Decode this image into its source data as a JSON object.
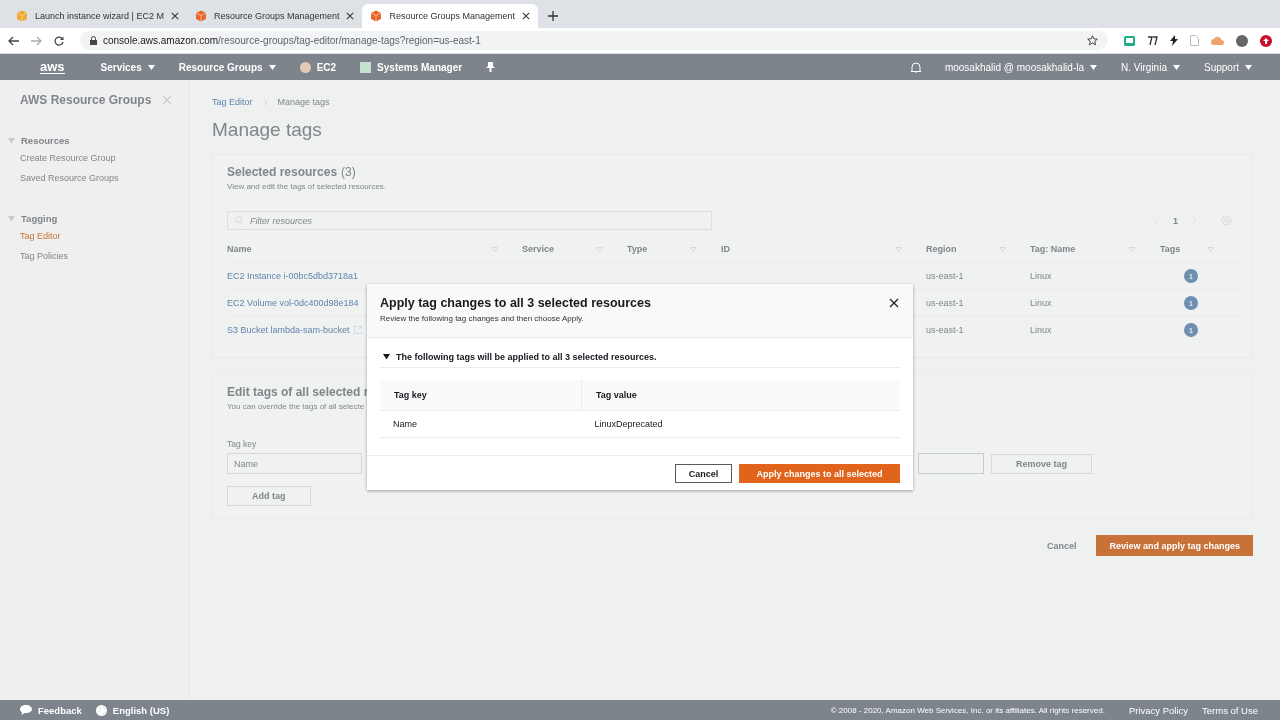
{
  "browser": {
    "tabs": [
      {
        "title": "Launch instance wizard | EC2 M",
        "kind": "ec2",
        "selected": false
      },
      {
        "title": "Resource Groups Management",
        "kind": "rg",
        "selected": false
      },
      {
        "title": "Resource Groups Management",
        "kind": "rg",
        "selected": true
      }
    ],
    "url_host": "console.aws.amazon.com",
    "url_path": "/resource-groups/tag-editor/manage-tags?region=us-east-1"
  },
  "nav": {
    "logo": "aws",
    "items": [
      {
        "label": "Services",
        "kind": "menu"
      },
      {
        "label": "Resource Groups",
        "kind": "menu"
      },
      {
        "label": "EC2",
        "kind": "ec2"
      },
      {
        "label": "Systems Manager",
        "kind": "ssm"
      }
    ],
    "account": "moosakhalid @ moosakhalid-la",
    "region": "N. Virginia",
    "support": "Support"
  },
  "sidebar": {
    "title": "AWS Resource Groups",
    "sections": [
      {
        "label": "Resources",
        "expanded": true,
        "items": [
          {
            "label": "Create Resource Group",
            "selected": false
          },
          {
            "label": "Saved Resource Groups",
            "selected": false
          }
        ]
      },
      {
        "label": "Tagging",
        "expanded": true,
        "items": [
          {
            "label": "Tag Editor",
            "selected": true
          },
          {
            "label": "Tag Policies",
            "selected": false
          }
        ]
      }
    ]
  },
  "breadcrumbs": [
    "Tag Editor",
    "Manage tags"
  ],
  "page_title": "Manage tags",
  "selected_resources": {
    "title": "Selected resources",
    "count": "(3)",
    "description": "View and edit the tags of selected resources.",
    "filter_placeholder": "Filter resources",
    "page": "1",
    "columns": [
      "Name",
      "Service",
      "Type",
      "ID",
      "Region",
      "Tag: Name",
      "Tags"
    ],
    "rows": [
      {
        "name": "EC2 Instance i-00bc5dbd3718a1",
        "external_link": false,
        "region": "us-east-1",
        "tag_name": "Linux",
        "tags": "1"
      },
      {
        "name": "EC2 Volume vol-0dc400d98e184",
        "external_link": false,
        "region": "us-east-1",
        "tag_name": "Linux",
        "tags": "1"
      },
      {
        "name": "S3 Bucket lambda-sam-bucket",
        "external_link": true,
        "region": "us-east-1",
        "tag_name": "Linux",
        "tags": "1"
      }
    ]
  },
  "edit_tags": {
    "title": "Edit tags of all selected r",
    "description": "You can override the tags of all selecte",
    "tag_key_label": "Tag key",
    "tag_key_value": "Name",
    "remove_button": "Remove tag",
    "add_button": "Add tag"
  },
  "actions": {
    "cancel": "Cancel",
    "submit": "Review and apply tag changes"
  },
  "modal": {
    "title": "Apply tag changes to all 3 selected resources",
    "subtitle": "Review the following tag changes and then choose Apply.",
    "section": {
      "label": "The following tags will be applied to all 3 selected resources.",
      "expanded": true
    },
    "columns": [
      "Tag key",
      "Tag value"
    ],
    "rows": [
      {
        "key": "Name",
        "value": "LinuxDeprecated"
      }
    ],
    "cancel": "Cancel",
    "confirm": "Apply changes to all selected"
  },
  "footer": {
    "feedback": "Feedback",
    "language": "English (US)",
    "copyright": "© 2008 - 2020, Amazon Web Services, Inc. or its affiliates. All rights reserved.",
    "links": [
      "Privacy Policy",
      "Terms of Use"
    ]
  }
}
